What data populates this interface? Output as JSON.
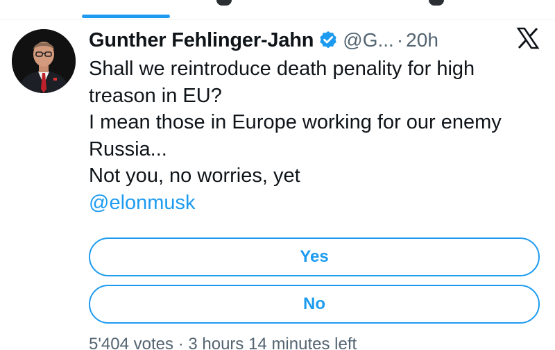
{
  "tweet": {
    "display_name": "Gunther Fehlinger-Jahn",
    "verified_icon": "verified-badge-icon",
    "handle": "@G...",
    "separator": "·",
    "time": "20h",
    "lines": [
      "Shall we reintroduce death penality for high",
      "treason in EU?",
      "I mean those in Europe working for our enemy",
      "Russia...",
      "Not you, no worries, yet"
    ],
    "mention": "@elonmusk"
  },
  "poll": {
    "options": [
      "Yes",
      "No"
    ],
    "votes": "5'404 votes",
    "separator": "·",
    "time_left": "3 hours 14 minutes left"
  },
  "icons": {
    "platform_logo": "x-logo-icon",
    "avatar": "avatar"
  },
  "colors": {
    "accent": "#1d9bf0",
    "text": "#0f1419",
    "secondary_text": "#536471"
  }
}
